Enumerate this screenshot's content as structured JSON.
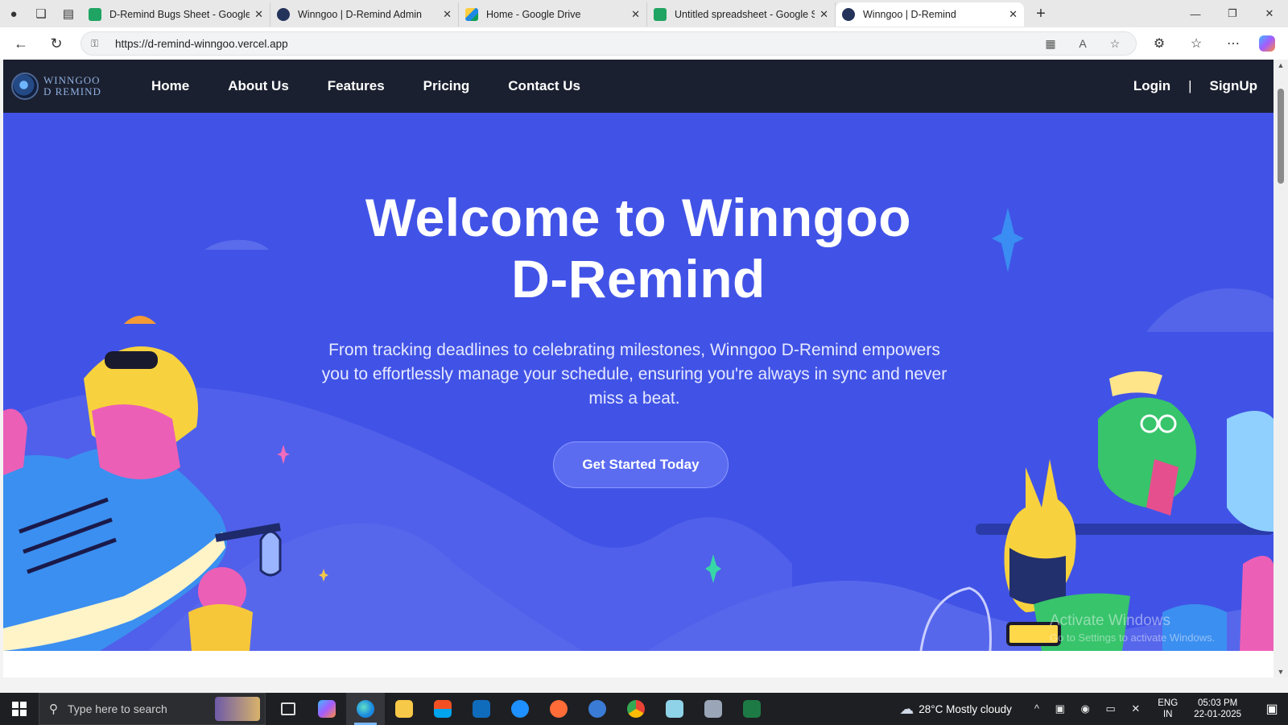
{
  "browser": {
    "tabs": [
      {
        "title": "D-Remind Bugs Sheet - Google Sheets",
        "icon": "sheets-icon",
        "active": false
      },
      {
        "title": "Winngoo | D-Remind Admin",
        "icon": "winngoo-icon",
        "active": false
      },
      {
        "title": "Home - Google Drive",
        "icon": "drive-icon",
        "active": false
      },
      {
        "title": "Untitled spreadsheet - Google Sheets",
        "icon": "sheets-icon",
        "active": false
      },
      {
        "title": "Winngoo | D-Remind",
        "icon": "winngoo-icon",
        "active": true
      }
    ],
    "url": "https://d-remind-winngoo.vercel.app"
  },
  "site": {
    "logo_line1": "Winngoo",
    "logo_line2": "D Remind",
    "nav": [
      "Home",
      "About Us",
      "Features",
      "Pricing",
      "Contact Us"
    ],
    "login": "Login",
    "separator": "|",
    "signup": "SignUp"
  },
  "hero": {
    "title_line1": "Welcome to Winngoo",
    "title_line2": "D-Remind",
    "subtitle": "From tracking deadlines to celebrating milestones, Winngoo D-Remind empowers you to effortlessly manage your schedule, ensuring you're always in sync and never miss a beat.",
    "cta": "Get Started Today",
    "colors": {
      "background": "#4153e6",
      "nav": "#1b2030",
      "cta": "#5b6cf0"
    }
  },
  "watermark": {
    "line1": "Activate Windows",
    "line2": "Go to Settings to activate Windows."
  },
  "taskbar": {
    "search_placeholder": "Type here to search",
    "weather": "28°C  Mostly cloudy",
    "lang_line1": "ENG",
    "lang_line2": "IN",
    "time": "05:03 PM",
    "date": "22-01-2025"
  }
}
